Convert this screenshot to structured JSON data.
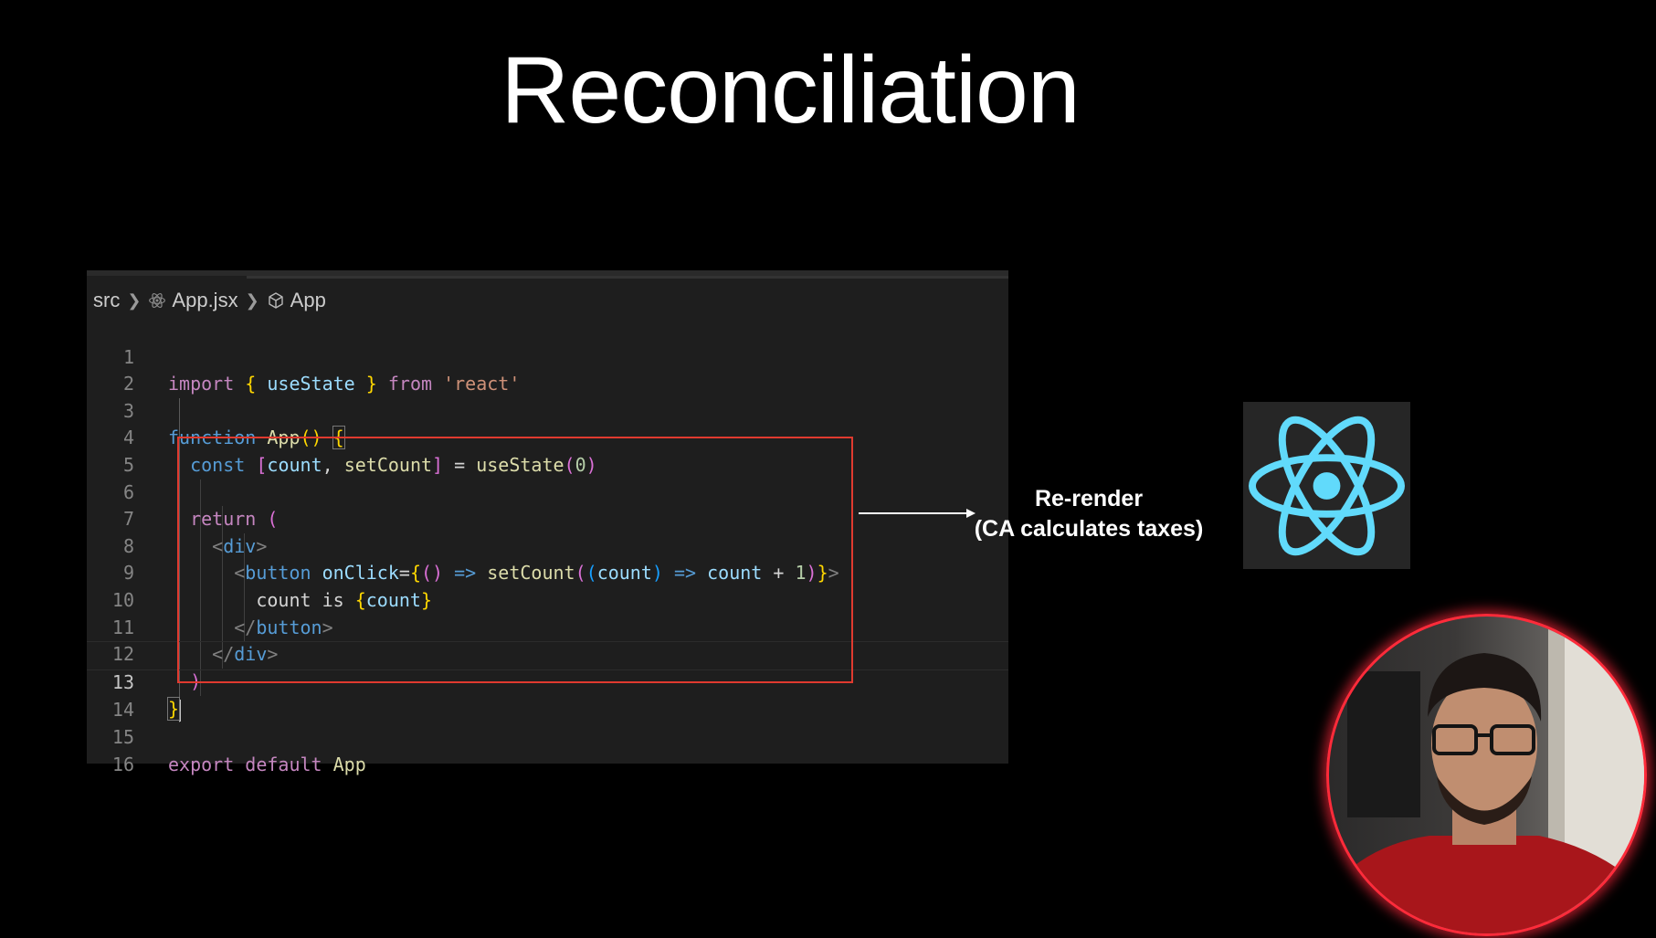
{
  "slide": {
    "title": "Reconciliation"
  },
  "editor": {
    "breadcrumb": {
      "folder": "src",
      "file": "App.jsx",
      "symbol": "App"
    },
    "line_numbers": [
      "1",
      "2",
      "3",
      "4",
      "5",
      "6",
      "7",
      "8",
      "9",
      "10",
      "11",
      "12",
      "13",
      "14",
      "15",
      "16"
    ],
    "current_line": "13",
    "code_lines": [
      "import { useState } from 'react'",
      "",
      "function App() {",
      "  const [count, setCount] = useState(0)",
      "",
      "  return (",
      "    <div>",
      "      <button onClick={() => setCount((count) => count + 1)}>",
      "        count is {count}",
      "      </button>",
      "    </div>",
      "  )",
      "}",
      "",
      "export default App",
      ""
    ]
  },
  "annotation": {
    "line1": "Re-render",
    "line2": "(CA calculates taxes)"
  },
  "colors": {
    "background": "#000000",
    "editor_bg": "#1e1e1e",
    "highlight_border": "#e03a2f",
    "react_blue": "#61dafb",
    "webcam_ring": "#ff2b3a"
  },
  "icons": {
    "breadcrumb_file": "react-atom-icon",
    "breadcrumb_symbol": "cube-icon",
    "logo": "react-logo-icon"
  }
}
